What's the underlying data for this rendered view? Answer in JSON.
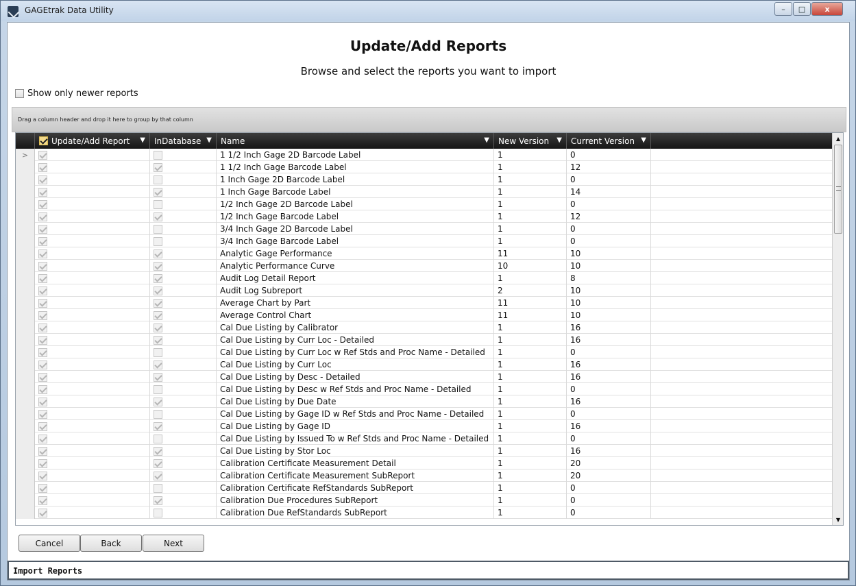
{
  "window": {
    "title": "GAGEtrak Data Utility",
    "controls": [
      "–",
      "□",
      "x"
    ]
  },
  "page": {
    "heading": "Update/Add Reports",
    "subheading": "Browse and select the reports you want to import",
    "show_newer_label": "Show only newer reports",
    "show_newer_checked": false,
    "group_panel_text": "Drag a column header and drop it here to group by that column"
  },
  "grid": {
    "columns": {
      "update_add": "Update/Add Report",
      "in_database": "InDatabase",
      "name": "Name",
      "new_version": "New Version",
      "current_version": "Current Version"
    },
    "current_row_indicator": ">",
    "rows": [
      {
        "update": true,
        "indb": false,
        "name": "1 1/2 Inch Gage 2D Barcode Label",
        "new": "1",
        "cur": "0"
      },
      {
        "update": true,
        "indb": true,
        "name": "1 1/2 Inch Gage Barcode Label",
        "new": "1",
        "cur": "12"
      },
      {
        "update": true,
        "indb": false,
        "name": "1 Inch Gage 2D Barcode Label",
        "new": "1",
        "cur": "0"
      },
      {
        "update": true,
        "indb": true,
        "name": "1 Inch Gage Barcode Label",
        "new": "1",
        "cur": "14"
      },
      {
        "update": true,
        "indb": false,
        "name": "1/2 Inch Gage 2D Barcode Label",
        "new": "1",
        "cur": "0"
      },
      {
        "update": true,
        "indb": true,
        "name": "1/2 Inch Gage Barcode Label",
        "new": "1",
        "cur": "12"
      },
      {
        "update": true,
        "indb": false,
        "name": "3/4 Inch Gage 2D Barcode Label",
        "new": "1",
        "cur": "0"
      },
      {
        "update": true,
        "indb": false,
        "name": "3/4 Inch Gage Barcode Label",
        "new": "1",
        "cur": "0"
      },
      {
        "update": true,
        "indb": true,
        "name": "Analytic Gage Performance",
        "new": "11",
        "cur": "10"
      },
      {
        "update": true,
        "indb": true,
        "name": "Analytic Performance Curve",
        "new": "10",
        "cur": "10"
      },
      {
        "update": true,
        "indb": true,
        "name": "Audit Log Detail Report",
        "new": "1",
        "cur": "8"
      },
      {
        "update": true,
        "indb": true,
        "name": "Audit Log Subreport",
        "new": "2",
        "cur": "10"
      },
      {
        "update": true,
        "indb": true,
        "name": "Average Chart by Part",
        "new": "11",
        "cur": "10"
      },
      {
        "update": true,
        "indb": true,
        "name": "Average Control Chart",
        "new": "11",
        "cur": "10"
      },
      {
        "update": true,
        "indb": true,
        "name": "Cal Due Listing by Calibrator",
        "new": "1",
        "cur": "16"
      },
      {
        "update": true,
        "indb": true,
        "name": "Cal Due Listing by Curr Loc - Detailed",
        "new": "1",
        "cur": "16"
      },
      {
        "update": true,
        "indb": false,
        "name": "Cal Due Listing by Curr Loc w Ref Stds and Proc Name - Detailed",
        "new": "1",
        "cur": "0"
      },
      {
        "update": true,
        "indb": true,
        "name": "Cal Due Listing by Curr Loc",
        "new": "1",
        "cur": "16"
      },
      {
        "update": true,
        "indb": true,
        "name": "Cal Due Listing by Desc - Detailed",
        "new": "1",
        "cur": "16"
      },
      {
        "update": true,
        "indb": false,
        "name": "Cal Due Listing by Desc w Ref Stds and Proc Name - Detailed",
        "new": "1",
        "cur": "0"
      },
      {
        "update": true,
        "indb": true,
        "name": "Cal Due Listing by Due Date",
        "new": "1",
        "cur": "16"
      },
      {
        "update": true,
        "indb": false,
        "name": "Cal Due Listing by Gage ID w Ref Stds and Proc Name - Detailed",
        "new": "1",
        "cur": "0"
      },
      {
        "update": true,
        "indb": true,
        "name": "Cal Due Listing by Gage ID",
        "new": "1",
        "cur": "16"
      },
      {
        "update": true,
        "indb": false,
        "name": "Cal Due Listing by Issued To w Ref Stds and Proc Name - Detailed",
        "new": "1",
        "cur": "0"
      },
      {
        "update": true,
        "indb": true,
        "name": "Cal Due Listing by Stor Loc",
        "new": "1",
        "cur": "16"
      },
      {
        "update": true,
        "indb": true,
        "name": "Calibration Certificate Measurement Detail",
        "new": "1",
        "cur": "20"
      },
      {
        "update": true,
        "indb": true,
        "name": "Calibration Certificate Measurement SubReport",
        "new": "1",
        "cur": "20"
      },
      {
        "update": true,
        "indb": false,
        "name": "Calibration Certificate RefStandards SubReport",
        "new": "1",
        "cur": "0"
      },
      {
        "update": true,
        "indb": true,
        "name": "Calibration Due Procedures SubReport",
        "new": "1",
        "cur": "0"
      },
      {
        "update": true,
        "indb": false,
        "name": "Calibration Due RefStandards SubReport",
        "new": "1",
        "cur": "0"
      }
    ]
  },
  "buttons": {
    "cancel": "Cancel",
    "back": "Back",
    "next": "Next"
  },
  "status": {
    "text": "Import Reports"
  }
}
